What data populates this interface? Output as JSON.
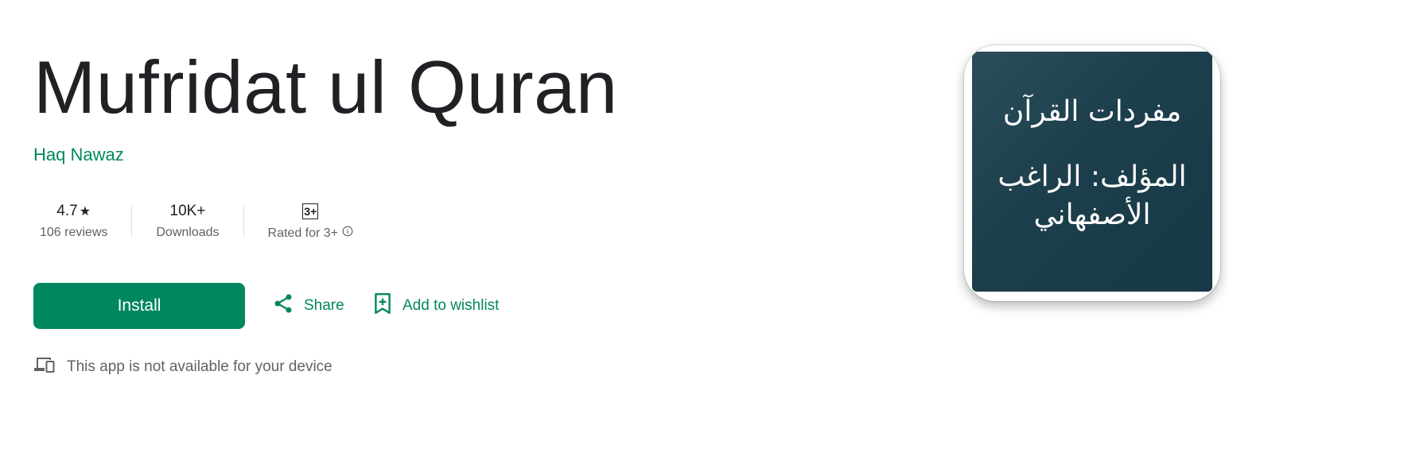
{
  "app": {
    "title": "Mufridat ul Quran",
    "developer": "Haq Nawaz",
    "icon_text_line1": "مفردات القرآن",
    "icon_text_line2": "المؤلف: الراغب الأصفهاني"
  },
  "stats": {
    "rating_value": "4.7",
    "rating_star": "★",
    "reviews_label": "106 reviews",
    "downloads_value": "10K+",
    "downloads_label": "Downloads",
    "content_rating_badge": "3+",
    "content_rating_label": "Rated for 3+"
  },
  "actions": {
    "install_label": "Install",
    "share_label": "Share",
    "wishlist_label": "Add to wishlist"
  },
  "availability": {
    "message": "This app is not available for your device"
  },
  "colors": {
    "accent": "#01875f",
    "text_primary": "#202124",
    "text_secondary": "#5f6368",
    "icon_bg": "#1d3f4c"
  },
  "icons": [
    "star-icon",
    "info-icon",
    "share-icon",
    "bookmark-add-icon",
    "devices-icon"
  ]
}
